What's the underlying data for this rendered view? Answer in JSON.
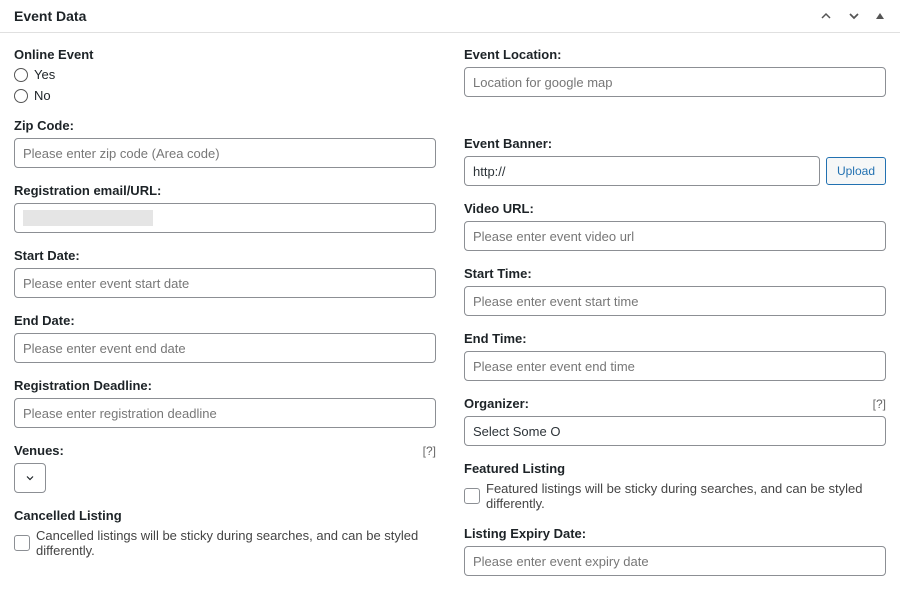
{
  "header": {
    "title": "Event Data"
  },
  "left": {
    "onlineEvent": {
      "label": "Online Event",
      "optYes": "Yes",
      "optNo": "No"
    },
    "zipCode": {
      "label": "Zip Code:",
      "placeholder": "Please enter zip code (Area code)"
    },
    "registrationEmail": {
      "label": "Registration email/URL:"
    },
    "startDate": {
      "label": "Start Date:",
      "placeholder": "Please enter event start date"
    },
    "endDate": {
      "label": "End Date:",
      "placeholder": "Please enter event end date"
    },
    "registrationDeadline": {
      "label": "Registration Deadline:",
      "placeholder": "Please enter registration deadline"
    },
    "venues": {
      "label": "Venues:",
      "help": "[?]"
    },
    "cancelledListing": {
      "label": "Cancelled Listing",
      "desc": "Cancelled listings will be sticky during searches, and can be styled differently."
    }
  },
  "right": {
    "eventLocation": {
      "label": "Event Location:",
      "placeholder": "Location for google map"
    },
    "eventBanner": {
      "label": "Event Banner:",
      "value": "http://",
      "uploadLabel": "Upload"
    },
    "videoUrl": {
      "label": "Video URL:",
      "placeholder": "Please enter event video url"
    },
    "startTime": {
      "label": "Start Time:",
      "placeholder": "Please enter event start time"
    },
    "endTime": {
      "label": "End Time:",
      "placeholder": "Please enter event end time"
    },
    "organizer": {
      "label": "Organizer:",
      "help": "[?]",
      "placeholder": "Select Some O"
    },
    "featuredListing": {
      "label": "Featured Listing",
      "desc": "Featured listings will be sticky during searches, and can be styled differently."
    },
    "listingExpiryDate": {
      "label": "Listing Expiry Date:",
      "placeholder": "Please enter event expiry date"
    }
  }
}
